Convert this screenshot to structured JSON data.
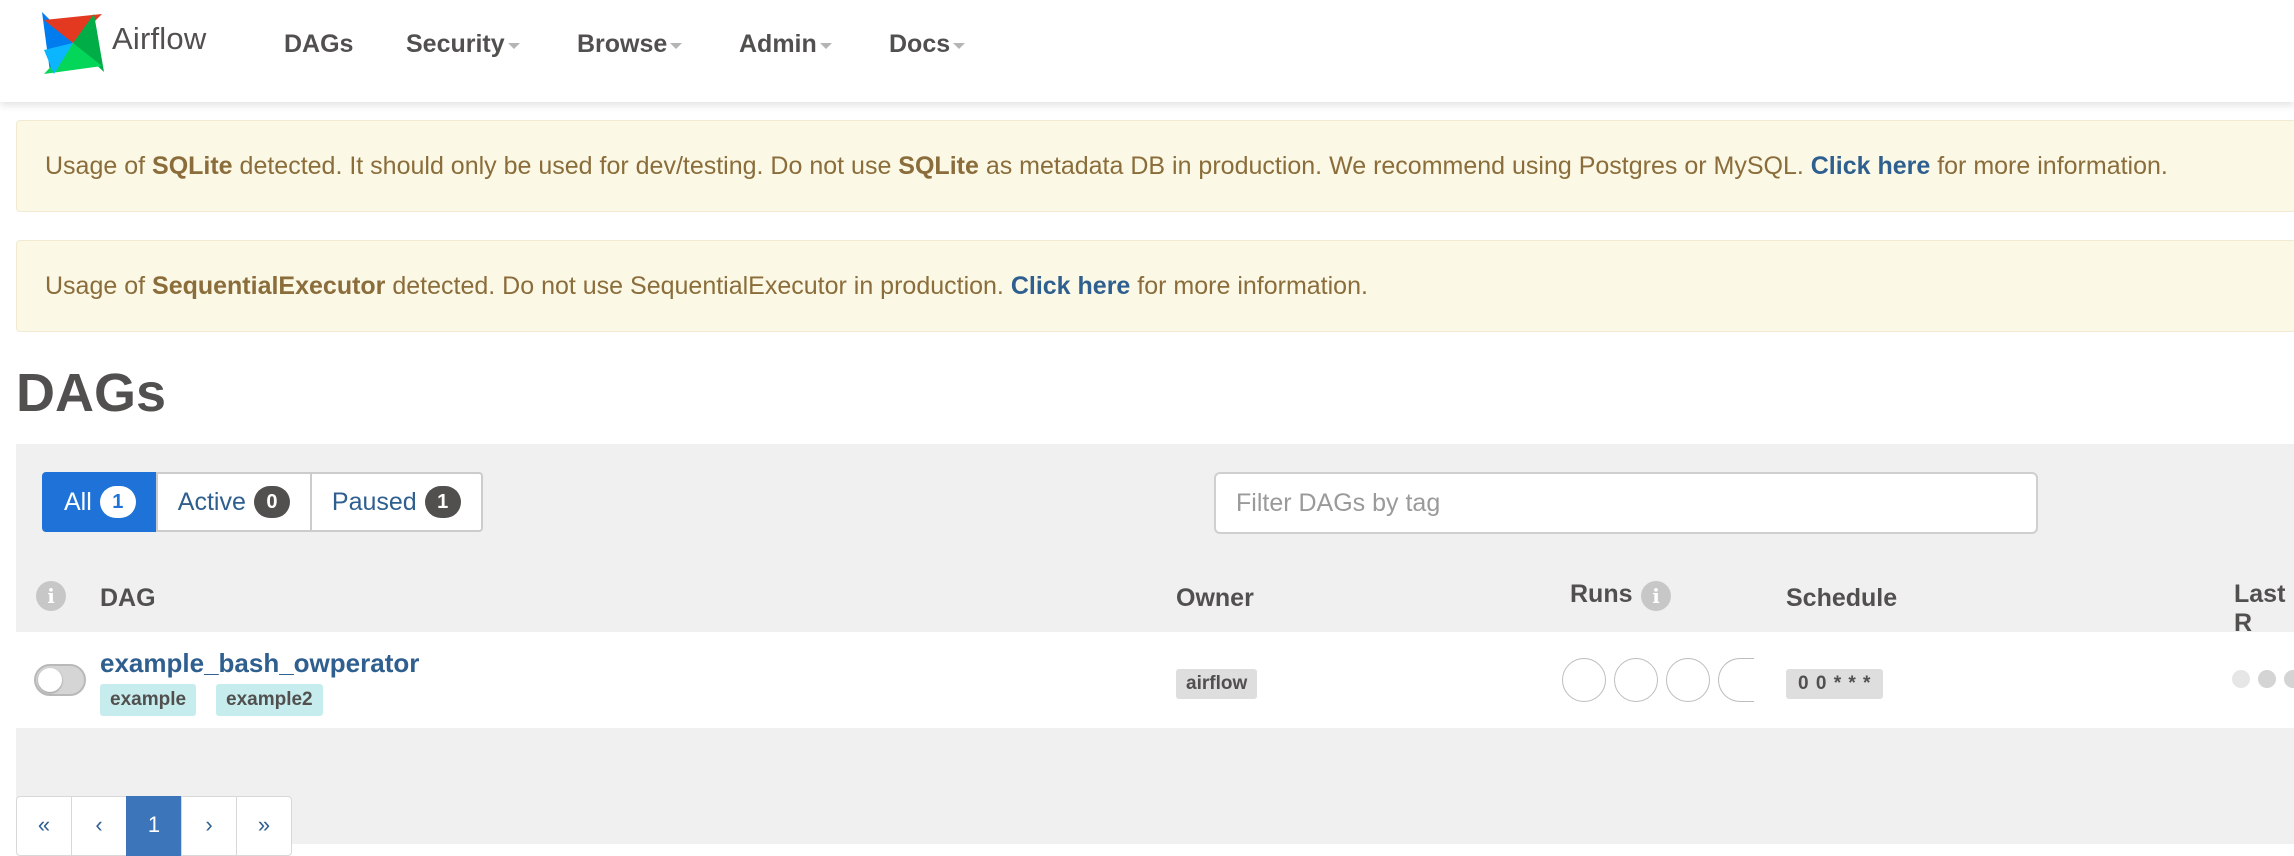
{
  "navbar": {
    "brand": "Airflow",
    "items": [
      {
        "label": "DAGs",
        "dropdown": false
      },
      {
        "label": "Security",
        "dropdown": true
      },
      {
        "label": "Browse",
        "dropdown": true
      },
      {
        "label": "Admin",
        "dropdown": true
      },
      {
        "label": "Docs",
        "dropdown": true
      }
    ]
  },
  "alerts": [
    {
      "parts": [
        "Usage of ",
        "SQLite",
        " detected. It should only be used for dev/testing. Do not use ",
        "SQLite",
        " as metadata DB in production. We recommend using Postgres or MySQL. ",
        "Click here",
        " for more information."
      ]
    },
    {
      "parts": [
        "Usage of ",
        "SequentialExecutor",
        " detected. Do not use SequentialExecutor in production. ",
        "Click here",
        " for more information."
      ]
    }
  ],
  "page": {
    "title": "DAGs"
  },
  "filters": [
    {
      "label": "All",
      "count": "1",
      "active": true
    },
    {
      "label": "Active",
      "count": "0",
      "active": false
    },
    {
      "label": "Paused",
      "count": "1",
      "active": false
    }
  ],
  "tag_filter": {
    "placeholder": "Filter DAGs by tag",
    "value": ""
  },
  "table": {
    "headers": {
      "dag": "DAG",
      "owner": "Owner",
      "runs": "Runs",
      "schedule": "Schedule",
      "last_run": "Last R"
    },
    "info_glyph": "i",
    "rows": [
      {
        "dag_id": "example_bash_owperator",
        "paused": true,
        "tags": [
          "example",
          "example2"
        ],
        "owner": "airflow",
        "schedule": "0 0 * * *"
      }
    ]
  },
  "pagination": {
    "items": [
      "«",
      "‹",
      "1",
      "›",
      "»"
    ],
    "active": "1"
  },
  "colors": {
    "brand_blue": "#017cee",
    "link": "#2f5f8f",
    "active_filter": "#1f73d8",
    "alert_bg": "#fbf8e5"
  }
}
